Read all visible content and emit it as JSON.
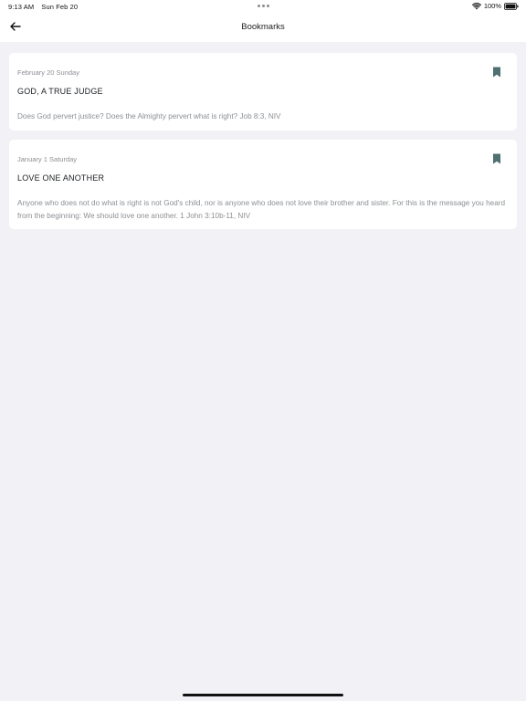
{
  "status_bar": {
    "time": "9:13 AM",
    "date": "Sun Feb 20",
    "battery": "100%",
    "wifi_icon": "wifi-icon",
    "battery_icon": "battery-full-icon"
  },
  "nav": {
    "title": "Bookmarks",
    "back_icon": "arrow-left-icon"
  },
  "bookmarks": [
    {
      "date": "February 20 Sunday",
      "title": "GOD, A TRUE JUDGE",
      "text": "Does God pervert justice? Does the Almighty pervert what is right? Job 8:3, NIV",
      "icon": "bookmark-icon"
    },
    {
      "date": "January 1 Saturday",
      "title": "LOVE ONE ANOTHER",
      "text": "Anyone who does not do what is right is not God's child, nor is anyone who does not love their brother and sister. For this is the message you heard from the beginning: We should love one another. 1 John 3:10b-11, NIV",
      "icon": "bookmark-icon"
    }
  ],
  "colors": {
    "background": "#f2f2f6",
    "card": "#ffffff",
    "bookmark_accent": "#4f6f71",
    "muted_text": "#8b8f94"
  }
}
